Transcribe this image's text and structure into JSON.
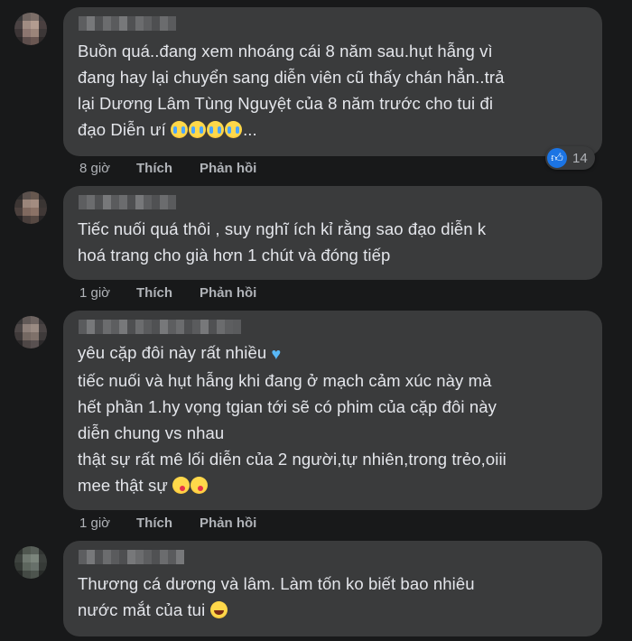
{
  "comments": [
    {
      "text": "Buồn quá..đang xem nhoáng cái 8 năm sau.hụt hẫng vì\nđang hay lại chuyển sang diễn viên cũ thấy chán hẳn..trả\nlại Dương Lâm Tùng Nguyệt của 8 năm trước cho tui đi\nđạo Diễn ưí ",
      "text_tail": "...",
      "time": "8 giờ",
      "like_label": "Thích",
      "reply_label": "Phản hồi",
      "reaction_count": "14",
      "reaction_icon": "like-icon"
    },
    {
      "text": "Tiếc nuối quá thôi , suy nghĩ ích kỉ rằng sao đạo diễn k\nhoá trang cho già hơn 1 chút và đóng tiếp",
      "time": "1 giờ",
      "like_label": "Thích",
      "reply_label": "Phản hồi"
    },
    {
      "text_line1": "yêu cặp đôi này rất nhiều ",
      "text_rest": "tiếc nuối và hụt hẫng khi đang ở mạch cảm xúc này mà\nhết phần 1.hy vọng tgian tới sẽ có phim của cặp đôi này\ndiễn chung vs nhau\nthật sự rất mê lối diễn của 2 người,tự nhiên,trong trẻo,oiii\nmee thật sự ",
      "time": "1 giờ",
      "like_label": "Thích",
      "reply_label": "Phản hồi"
    },
    {
      "text": "Thương cá dương và lâm. Làm tốn ko biết bao nhiêu\nnước mắt của tui ",
      "time": "",
      "like_label": "",
      "reply_label": ""
    }
  ],
  "colors": {
    "background": "#18191a",
    "bubble": "#3a3b3c",
    "text": "#e4e6eb",
    "meta": "#b0b3b8",
    "like_blue": "#1b74e4",
    "heart": "#58b8f7"
  }
}
